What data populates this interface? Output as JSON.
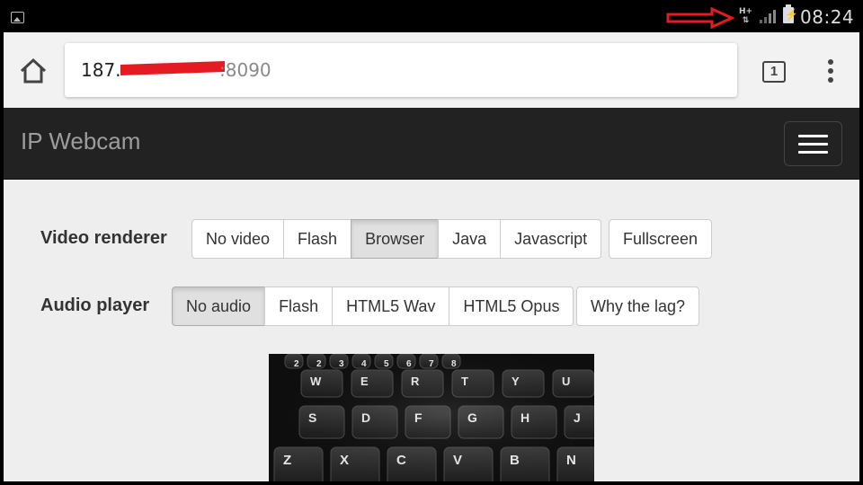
{
  "status_bar": {
    "network_type": "H+",
    "time": "08:24",
    "annotation_color": "#e41b23"
  },
  "browser": {
    "url_host": "187.",
    "url_port": ":8090",
    "tab_count": "1"
  },
  "navbar": {
    "brand": "IP Webcam"
  },
  "video_renderer": {
    "label": "Video renderer",
    "options": [
      "No video",
      "Flash",
      "Browser",
      "Java",
      "Javascript"
    ],
    "selected": "Browser",
    "extra_button": "Fullscreen"
  },
  "audio_player": {
    "label": "Audio player",
    "options": [
      "No audio",
      "Flash",
      "HTML5 Wav",
      "HTML5 Opus"
    ],
    "selected": "No audio",
    "extra_button": "Why the lag?"
  },
  "video_feed": {
    "key_rows": [
      [
        "2",
        "2",
        "3",
        "4",
        "5",
        "6",
        "7",
        "8"
      ],
      [
        "W",
        "E",
        "R",
        "T",
        "Y",
        "U"
      ],
      [
        "S",
        "D",
        "F",
        "G",
        "H",
        "J"
      ],
      [
        "Z",
        "X",
        "C",
        "V",
        "B",
        "N"
      ]
    ]
  }
}
